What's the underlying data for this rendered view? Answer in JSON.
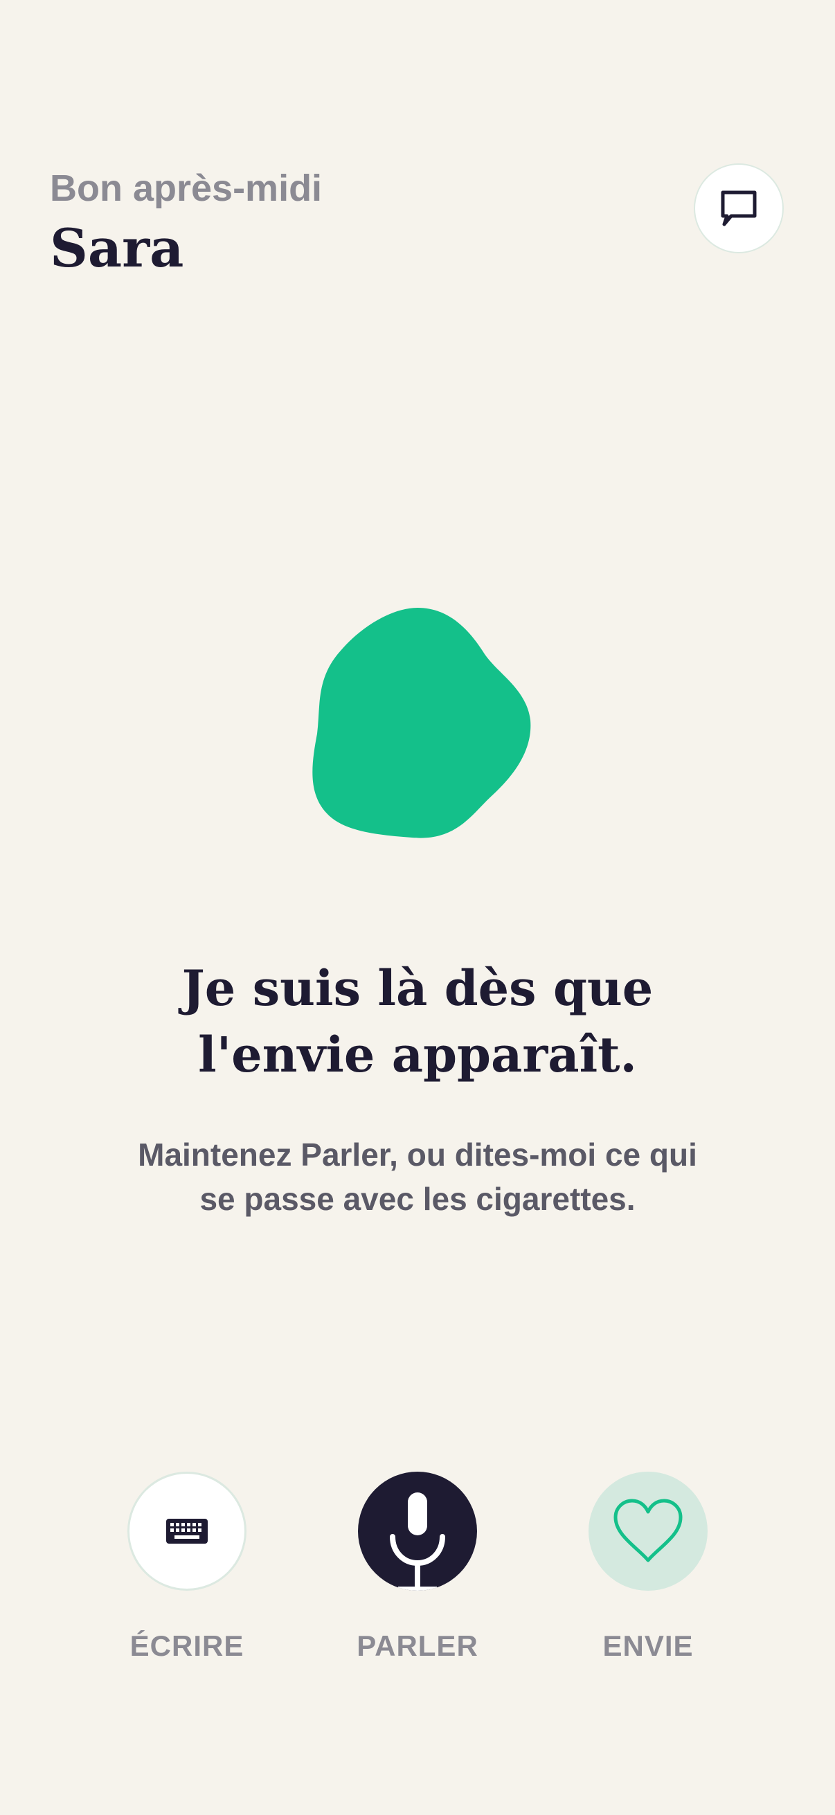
{
  "header": {
    "greeting": "Bon après-midi",
    "username": "Sara"
  },
  "hero": {
    "headline_line1": "Je suis là dès que",
    "headline_line2": "l'envie apparaît.",
    "subtitle_line1": "Maintenez Parler, ou dites-moi ce qui",
    "subtitle_line2": "se passe avec les cigarettes."
  },
  "actions": {
    "write_label": "ÉCRIRE",
    "speak_label": "PARLER",
    "craving_label": "ENVIE"
  },
  "icons": {
    "chat": "chat-bubble-icon",
    "write": "keyboard-icon",
    "speak": "microphone-icon",
    "craving": "heart-icon"
  },
  "colors": {
    "background": "#f6f3ec",
    "accent_green": "#14c08a",
    "dark_navy": "#1e1b32",
    "muted_gray": "#8b8a93",
    "light_green": "#d4e9df"
  }
}
